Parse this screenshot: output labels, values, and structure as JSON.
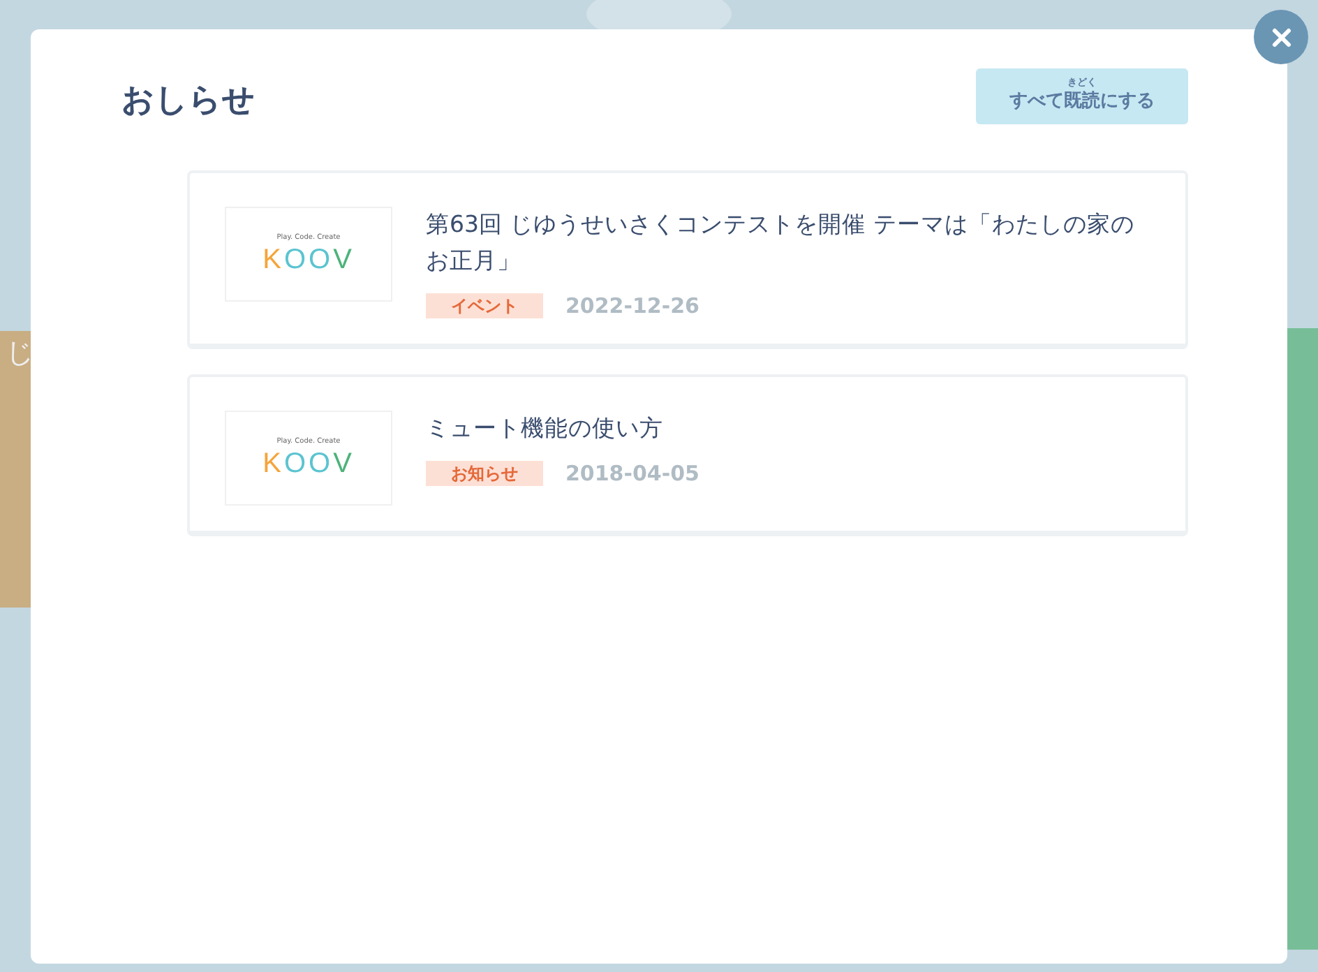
{
  "background": {
    "partial_label": "じ"
  },
  "dialog": {
    "title": "おしらせ",
    "mark_all_read": {
      "before": "すべて",
      "base": "既読",
      "ruby": "きどく",
      "after": "にする"
    },
    "items": [
      {
        "logo_tagline": "Play. Code. Create",
        "logo_text": "KOOV",
        "title": "第63回 じゆうせいさくコンテストを開催 テーマは「わたしの家のお正月」",
        "tag": "イベント",
        "date": "2022-12-26"
      },
      {
        "logo_tagline": "Play. Code. Create",
        "logo_text": "KOOV",
        "title": "ミュート機能の使い方",
        "tag": "お知らせ",
        "date": "2018-04-05"
      }
    ]
  }
}
